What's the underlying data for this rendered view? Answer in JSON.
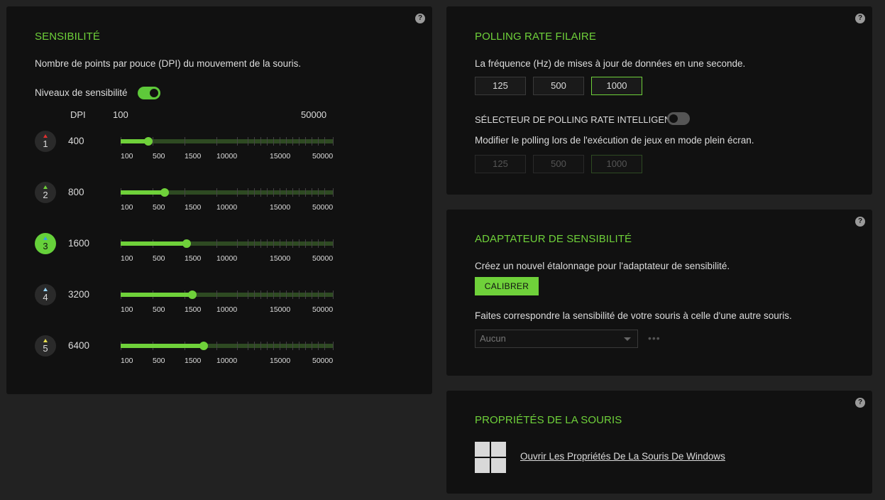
{
  "help_label": "?",
  "sensitivity": {
    "title": "SENSIBILITÉ",
    "description": "Nombre de points par pouce (DPI) du mouvement de la souris.",
    "levels_label": "Niveaux de sensibilité",
    "levels_enabled": true,
    "header_dpi": "DPI",
    "header_min": "100",
    "header_max": "50000",
    "scale_labels": [
      "100",
      "500",
      "1500",
      "10000",
      "15000",
      "50000"
    ],
    "stages": [
      {
        "number": "1",
        "dpi": "400",
        "color": "#e03030",
        "active": false,
        "fraction": 0.13
      },
      {
        "number": "2",
        "dpi": "800",
        "color": "#6fd13a",
        "active": false,
        "fraction": 0.207
      },
      {
        "number": "3",
        "dpi": "1600",
        "color": "#3aa0e0",
        "active": true,
        "fraction": 0.31
      },
      {
        "number": "4",
        "dpi": "3200",
        "color": "#9ad8ff",
        "active": false,
        "fraction": 0.337
      },
      {
        "number": "5",
        "dpi": "6400",
        "color": "#e8e050",
        "active": false,
        "fraction": 0.39
      }
    ],
    "accent_color": "#6fd13a"
  },
  "polling": {
    "title": "POLLING RATE FILAIRE",
    "description": "La fréquence (Hz) de mises à jour de données en une seconde.",
    "rates": [
      "125",
      "500",
      "1000"
    ],
    "selected": "1000",
    "smart_label": "SÉLECTEUR DE POLLING RATE INTELLIGENT",
    "smart_enabled": false,
    "smart_description": "Modifier le polling lors de l'exécution de jeux en mode plein écran.",
    "smart_rates": [
      "125",
      "500",
      "1000"
    ],
    "smart_selected": "1000"
  },
  "adapter": {
    "title": "ADAPTATEUR DE SENSIBILITÉ",
    "description": "Créez un nouvel étalonnage pour l'adaptateur de sensibilité.",
    "calibrate_label": "CALIBRER",
    "match_description": "Faites correspondre la sensibilité de votre souris à celle d'une autre souris.",
    "select_value": "Aucun",
    "more_label": "•••"
  },
  "properties": {
    "title": "PROPRIÉTÉS DE LA SOURIS",
    "link": "Ouvrir Les Propriétés De La Souris De Windows",
    "icon": "windows-logo-icon"
  }
}
